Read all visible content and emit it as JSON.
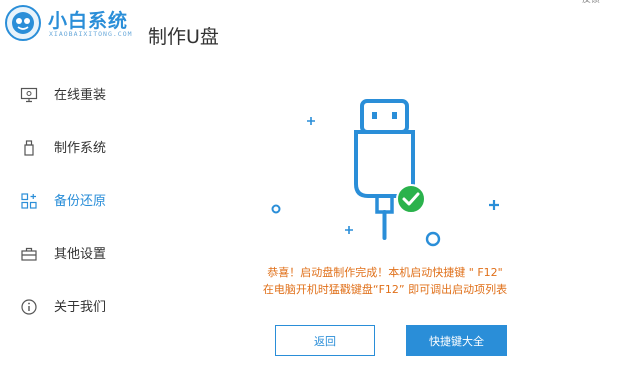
{
  "app": {
    "brand_name": "小白系统",
    "brand_sub": "XIAOBAIXITONG.COM",
    "page_title": "制作U盘",
    "top_right": "反馈"
  },
  "sidebar": {
    "items": [
      {
        "label": "在线重装",
        "icon": "monitor-icon"
      },
      {
        "label": "制作系统",
        "icon": "usb-drive-icon"
      },
      {
        "label": "备份还原",
        "icon": "backup-grid-icon",
        "active": true
      },
      {
        "label": "其他设置",
        "icon": "toolbox-icon"
      },
      {
        "label": "关于我们",
        "icon": "info-icon"
      }
    ]
  },
  "main": {
    "message_line1": "恭喜！启动盘制作完成！本机启动快捷键 \" F12\"",
    "message_line2": "在电脑开机时猛戳键盘“F12” 即可调出启动项列表",
    "back_label": "返回",
    "shortcut_label": "快捷键大全"
  },
  "colors": {
    "accent": "#2a8ed8",
    "message": "#e0701a",
    "success": "#2bb24c"
  }
}
